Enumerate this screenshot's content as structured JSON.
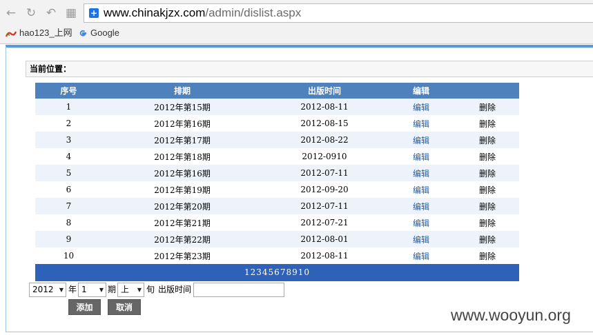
{
  "browser": {
    "url_host": "www.chinakjzx.com",
    "url_path": "/admin/dislist.aspx",
    "bookmarks": [
      {
        "label": "hao123_上网",
        "icon": "hao123-icon"
      },
      {
        "label": "Google",
        "icon": "google-icon"
      }
    ]
  },
  "location_label": "当前位置：",
  "table": {
    "headers": [
      "序号",
      "排期",
      "出版时间",
      "编辑",
      ""
    ],
    "rows": [
      {
        "no": "1",
        "issue": "2012年第15期",
        "date": "2012-08-11",
        "edit": "编辑",
        "del": "删除"
      },
      {
        "no": "2",
        "issue": "2012年第16期",
        "date": "2012-08-15",
        "edit": "编辑",
        "del": "删除"
      },
      {
        "no": "3",
        "issue": "2012年第17期",
        "date": "2012-08-22",
        "edit": "编辑",
        "del": "删除"
      },
      {
        "no": "4",
        "issue": "2012年第18期",
        "date": "2012-0910",
        "edit": "编辑",
        "del": "删除"
      },
      {
        "no": "5",
        "issue": "2012年第16期",
        "date": "2012-07-11",
        "edit": "编辑",
        "del": "删除"
      },
      {
        "no": "6",
        "issue": "2012年第19期",
        "date": "2012-09-20",
        "edit": "编辑",
        "del": "删除"
      },
      {
        "no": "7",
        "issue": "2012年第20期",
        "date": "2012-07-11",
        "edit": "编辑",
        "del": "删除"
      },
      {
        "no": "8",
        "issue": "2012年第21期",
        "date": "2012-07-21",
        "edit": "编辑",
        "del": "删除"
      },
      {
        "no": "9",
        "issue": "2012年第22期",
        "date": "2012-08-01",
        "edit": "编辑",
        "del": "删除"
      },
      {
        "no": "10",
        "issue": "2012年第23期",
        "date": "2012-08-11",
        "edit": "编辑",
        "del": "删除"
      }
    ]
  },
  "pager": {
    "pages": [
      "1",
      "2",
      "3",
      "4",
      "5",
      "6",
      "7",
      "8",
      "9",
      "10"
    ]
  },
  "form": {
    "year_value": "2012",
    "year_label": "年",
    "issue_value": "1",
    "issue_label": "期",
    "half_value": "上",
    "half_label": "旬",
    "date_label": "出版时间",
    "date_value": ""
  },
  "buttons": {
    "add": "添加",
    "cancel": "取消"
  },
  "watermark": "www.wooyun.org",
  "colors": {
    "header": "#4f81bd",
    "pager": "#2e62b9",
    "link": "#1f5fa8",
    "alt_row": "#eef3fb"
  }
}
